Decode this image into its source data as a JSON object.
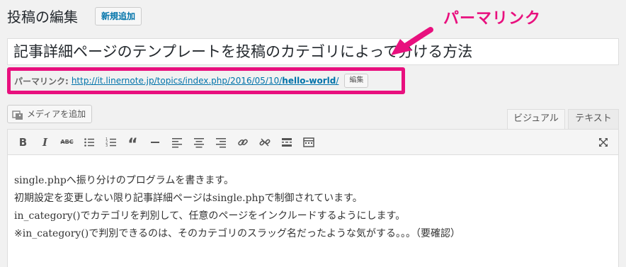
{
  "header": {
    "page_title": "投稿の編集",
    "add_new_label": "新規追加"
  },
  "annotation": {
    "label": "パーマリンク",
    "color": "#e8107e"
  },
  "post": {
    "title": "記事詳細ページのテンプレートを投稿のカテゴリによって分ける方法"
  },
  "permalink": {
    "label": "パーマリンク:",
    "url_base": "http://it.linernote.jp/topics/index.php/2016/05/10/",
    "slug": "hello-world",
    "url_trailing": "/",
    "edit_label": "編集"
  },
  "editor": {
    "add_media_label": "メディアを追加",
    "tabs": {
      "visual": "ビジュアル",
      "text": "テキスト"
    },
    "toolbar": [
      "bold-icon",
      "italic-icon",
      "strikethrough-icon",
      "bullet-list-icon",
      "numbered-list-icon",
      "blockquote-icon",
      "horizontal-rule-icon",
      "align-left-icon",
      "align-center-icon",
      "align-right-icon",
      "insert-link-icon",
      "remove-link-icon",
      "read-more-icon",
      "toolbar-toggle-icon",
      "fullscreen-icon"
    ],
    "content": [
      "single.phpへ振り分けのプログラムを書きます。",
      "初期設定を変更しない限り記事詳細ページはsingle.phpで制御されています。",
      "in_category()でカテゴリを判別して、任意のページをインクルードするようにします。",
      "※in_category()で判別できるのは、そのカテゴリのスラッグ名だったような気がする。。。（要確認）"
    ]
  }
}
